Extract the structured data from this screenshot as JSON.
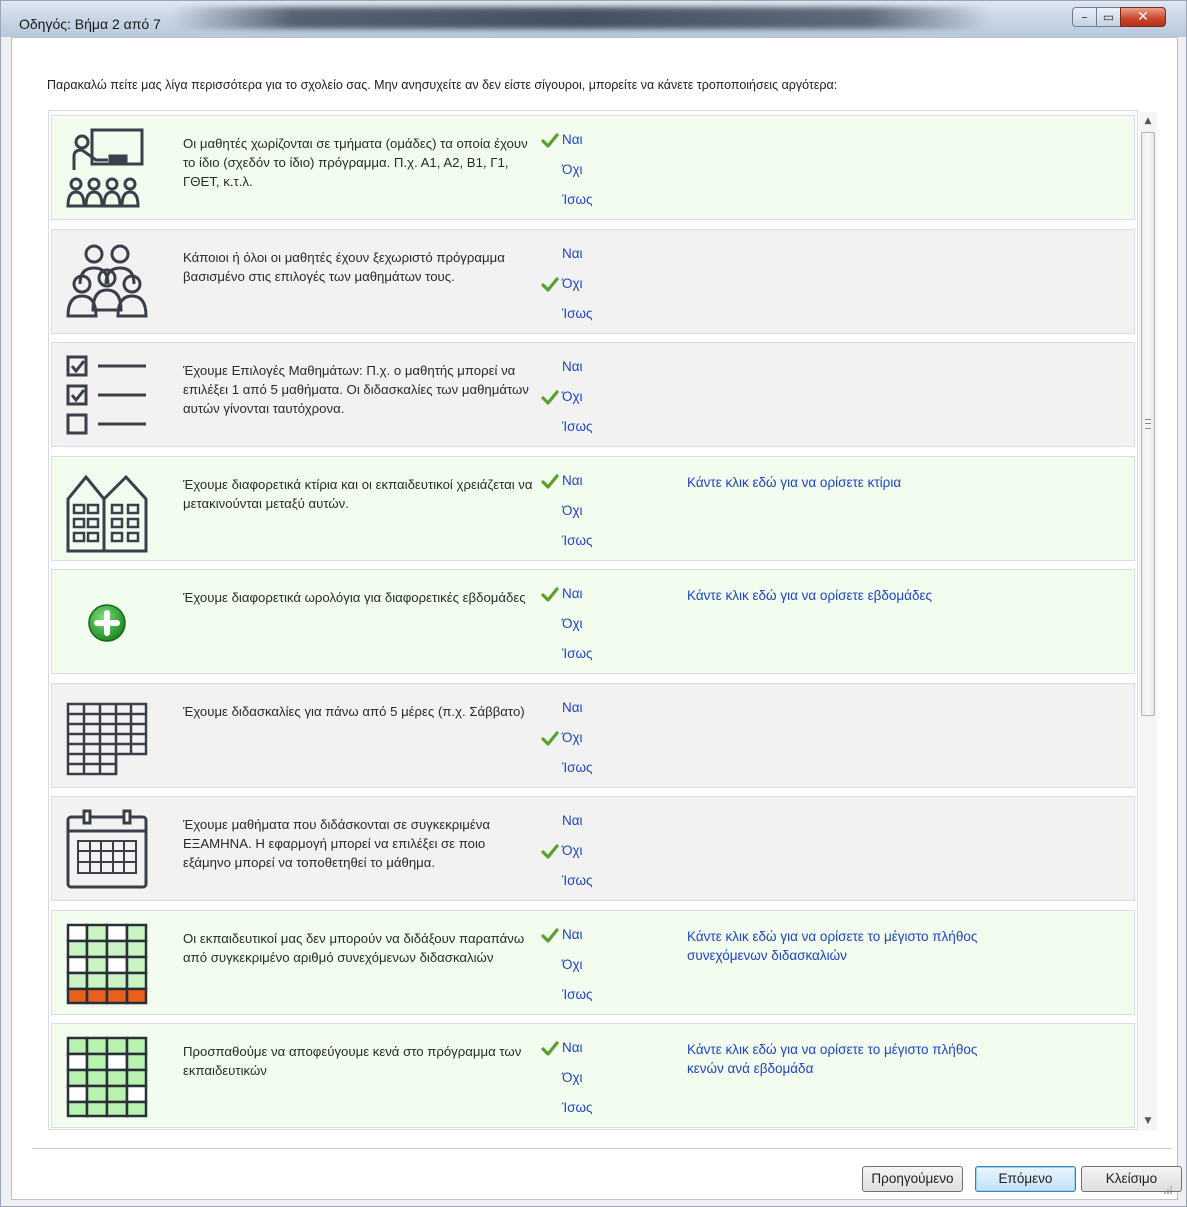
{
  "window": {
    "title": "Οδηγός: Βήμα 2 από 7",
    "controls": {
      "minimize": "–",
      "maximize": "▭",
      "close": "✕"
    }
  },
  "intro": "Παρακαλώ πείτε μας λίγα περισσότερα για το σχολείο σας. Μην ανησυχείτε αν δεν είστε σίγουροι, μπορείτε να κάνετε τροποποιήσεις αργότερα:",
  "option_labels": {
    "yes": "Ναι",
    "no": "Όχι",
    "maybe": "Ίσως"
  },
  "rows": [
    {
      "icon": "classroom-icon",
      "text": "Οι μαθητές χωρίζονται σε τμήματα (ομάδες) τα οποία έχουν το ίδιο (σχεδόν το ίδιο) πρόγραμμα. Π.χ. Α1, Α2, Β1, Γ1, ΓΘΕΤ, κ.τ.λ.",
      "selected": "yes",
      "link": ""
    },
    {
      "icon": "students-group-icon",
      "text": "Κάποιοι ή όλοι οι μαθητές έχουν ξεχωριστό πρόγραμμα βασισμένο στις επιλογές των μαθημάτων τους.",
      "selected": "no",
      "link": ""
    },
    {
      "icon": "checklist-icon",
      "text": "Έχουμε Επιλογές Μαθημάτων: Π.χ. ο μαθητής μπορεί να επιλέξει 1 από 5 μαθήματα. Οι διδασκαλίες των μαθημάτων αυτών γίνονται ταυτόχρονα.",
      "selected": "no",
      "link": ""
    },
    {
      "icon": "buildings-icon",
      "text": "Έχουμε διαφορετικά κτίρια και οι εκπαιδευτικοί χρειάζεται να μετακινούνται μεταξύ αυτών.",
      "selected": "yes",
      "link": "Κάντε κλικ εδώ για να ορίσετε κτίρια"
    },
    {
      "icon": "add-plus-icon",
      "text": "Έχουμε διαφορετικά ωρολόγια για διαφορετικές εβδομάδες",
      "selected": "yes",
      "link": "Κάντε κλικ εδώ για να ορίσετε εβδομάδες"
    },
    {
      "icon": "week-grid-icon",
      "text": "Έχουμε διδασκαλίες για πάνω από 5 μέρες (π.χ. Σάββατο)",
      "selected": "no",
      "link": ""
    },
    {
      "icon": "calendar-icon",
      "text": "Έχουμε μαθήματα που διδάσκονται σε συγκεκριμένα ΕΞΑΜΗΝΑ. Η εφαρμογή μπορεί να επιλέξει σε ποιο εξάμηνο μπορεί να τοποθετηθεί το μάθημα.",
      "selected": "no",
      "link": ""
    },
    {
      "icon": "consecutive-lessons-icon",
      "text": "Οι εκπαιδευτικοί μας δεν μπορούν να διδάξουν παραπάνω από συγκεκριμένο αριθμό συνεχόμενων διδασκαλιών",
      "selected": "yes",
      "link": "Κάντε κλικ εδώ για να ορίσετε το μέγιστο πλήθος συνεχόμενων διδασκαλιών"
    },
    {
      "icon": "gaps-grid-icon",
      "text": "Προσπαθούμε να αποφεύγουμε κενά στο πρόγραμμα των εκπαιδευτικών",
      "selected": "yes",
      "link": "Κάντε κλικ εδώ για να ορίσετε το μέγιστο πλήθος κενών ανά εβδομάδα"
    }
  ],
  "buttons": {
    "previous": "Προηγούμενο",
    "next": "Επόμενο",
    "close": "Κλείσιμο"
  },
  "colors": {
    "link": "#1f43c9",
    "check": "#5aa02c",
    "highlight_row": "#f2fdf0",
    "plain_row": "#f2f2f2"
  }
}
